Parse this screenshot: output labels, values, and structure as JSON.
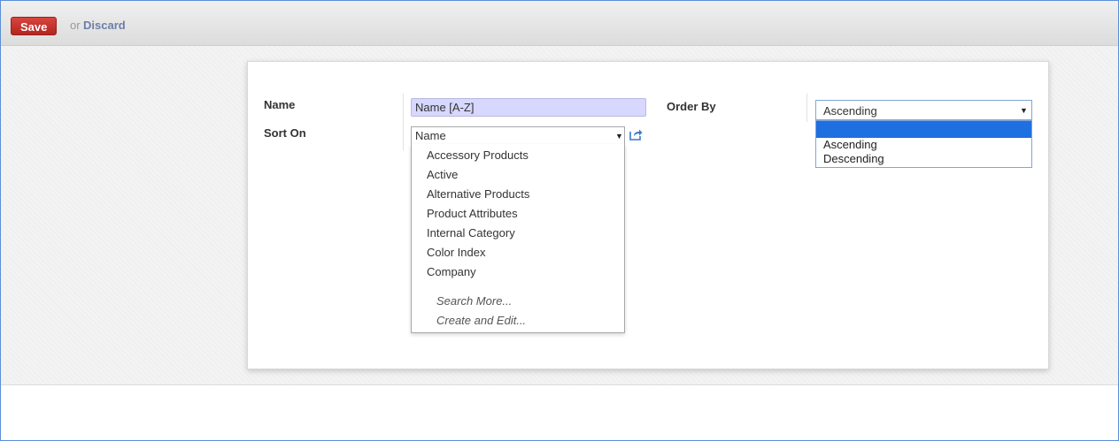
{
  "toolbar": {
    "save_label": "Save",
    "or_text": "or",
    "discard_label": "Discard"
  },
  "form": {
    "name_label": "Name",
    "name_value": "Name [A-Z]",
    "sort_on_label": "Sort On",
    "sort_on_value": "Name",
    "order_by_label": "Order By",
    "order_by_value": "Ascending"
  },
  "sort_dropdown": {
    "options": [
      "Accessory Products",
      "Active",
      "Alternative Products",
      "Product Attributes",
      "Internal Category",
      "Color Index",
      "Company"
    ],
    "search_more": "Search More...",
    "create_and_edit": "Create and Edit..."
  },
  "order_dropdown": {
    "highlighted_option": "",
    "options": [
      "Ascending",
      "Descending"
    ]
  },
  "colors": {
    "save_button": "#c9302c",
    "name_input_bg": "#d7d7ff",
    "order_highlight": "#1e6fe0",
    "discard_link": "#6a7fa8"
  }
}
